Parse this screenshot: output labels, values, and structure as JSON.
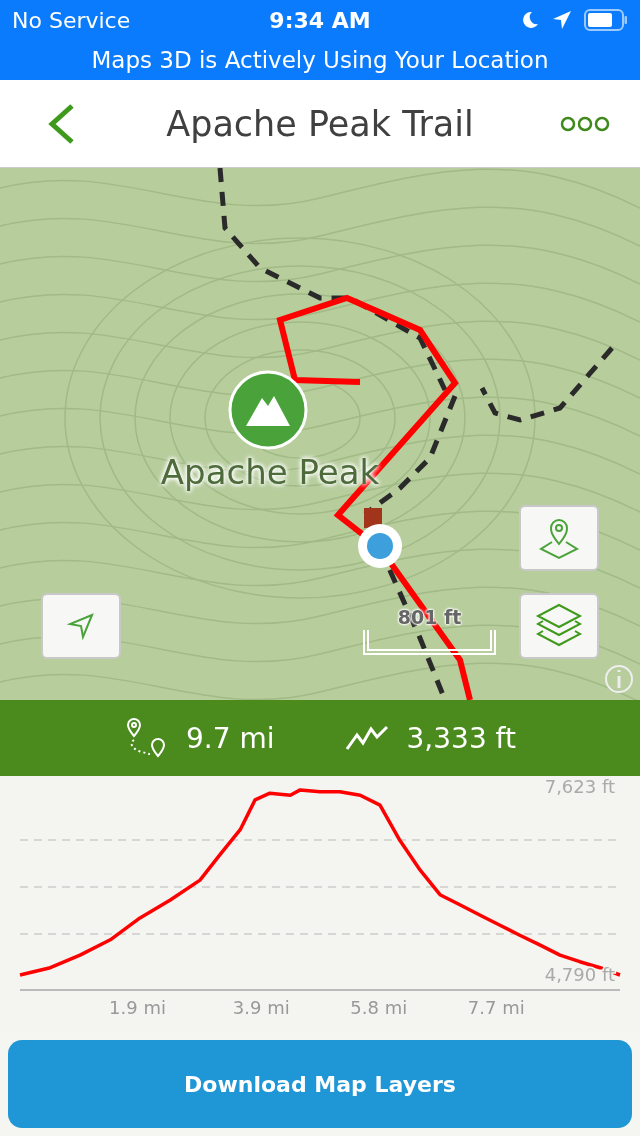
{
  "status_bar": {
    "carrier": "No Service",
    "time": "9:34 AM"
  },
  "location_banner": "Maps 3D is Actively Using Your Location",
  "nav": {
    "title": "Apache Peak Trail"
  },
  "map": {
    "peak_label": "Apache Peak",
    "scale": "801 ft"
  },
  "stats": [
    {
      "kind": "distance",
      "value": "9.7 mi"
    },
    {
      "kind": "elevation_gain",
      "value": "3,333 ft"
    }
  ],
  "elevation_chart": {
    "chart_data": {
      "type": "line",
      "x": [
        0,
        0.49,
        0.97,
        1.46,
        1.94,
        2.43,
        2.91,
        3.23,
        3.56,
        3.8,
        4.04,
        4.37,
        4.53,
        4.85,
        5.17,
        5.5,
        5.82,
        6.14,
        6.47,
        6.79,
        7.11,
        7.44,
        7.76,
        8.08,
        8.41,
        8.73,
        9.05,
        9.38,
        9.7
      ],
      "values": [
        4790,
        4900,
        5090,
        5320,
        5650,
        5920,
        6220,
        6600,
        6980,
        7430,
        7530,
        7500,
        7580,
        7550,
        7550,
        7500,
        7350,
        6820,
        6370,
        6000,
        5850,
        5690,
        5540,
        5390,
        5240,
        5090,
        4990,
        4900,
        4790
      ],
      "xlim": [
        0,
        9.7
      ],
      "ylim": [
        3931,
        7789
      ],
      "xticks": [
        {
          "value": 1.9,
          "label": "1.9 mi"
        },
        {
          "value": 3.9,
          "label": "3.9 mi"
        },
        {
          "value": 5.8,
          "label": "5.8 mi"
        },
        {
          "value": 7.7,
          "label": "7.7 mi"
        }
      ],
      "yticks": [
        {
          "value": 7623,
          "label": "7,623 ft"
        },
        {
          "value": 4790,
          "label": "4,790 ft"
        }
      ]
    }
  },
  "download_button": "Download Map Layers"
}
